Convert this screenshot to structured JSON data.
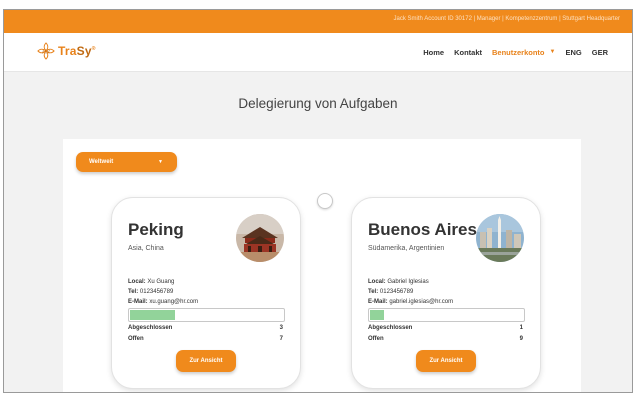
{
  "topbar": {
    "info": "Jack Smith Account ID 30172 | Manager | Kompetenzzentrum | Stuttgart Headquarter",
    "color": "#f08a1c"
  },
  "nav": {
    "logo_text_1": "Tra",
    "logo_text_2": "Sy",
    "logo_sup": "®",
    "items": [
      {
        "label": "Home"
      },
      {
        "label": "Kontakt"
      },
      {
        "label": "Benutzerkonto"
      },
      {
        "label": "ENG"
      },
      {
        "label": "GER"
      }
    ],
    "active_caret": "▼"
  },
  "page": {
    "title": "Delegierung von Aufgaben"
  },
  "filter": {
    "selected": "Weltweit",
    "caret": "▼"
  },
  "cards": [
    {
      "city": "Peking",
      "region": "Asia, China",
      "local_label": "Local:",
      "local": "Xu Guang",
      "tel_label": "Tel:",
      "tel": "0123456789",
      "email_label": "E-Mail:",
      "email": "xu.guang@hr.com",
      "progress": 0.3,
      "done_label": "Abgeschlossen",
      "done": "3",
      "open_label": "Offen",
      "open": "7",
      "button": "Zur Ansicht"
    },
    {
      "city": "Buenos Aires",
      "region": "Südamerika, Argentinien",
      "local_label": "Local:",
      "local": "Gabriel Iglesias",
      "tel_label": "Tel:",
      "tel": "0123456789",
      "email_label": "E-Mail:",
      "email": "gabriel.iglesias@hr.com",
      "progress": 0.1,
      "done_label": "Abgeschlossen",
      "done": "1",
      "open_label": "Offen",
      "open": "9",
      "button": "Zur Ansicht"
    }
  ],
  "colors": {
    "accent": "#f08a1c",
    "progress_fill": "#92d39a"
  }
}
